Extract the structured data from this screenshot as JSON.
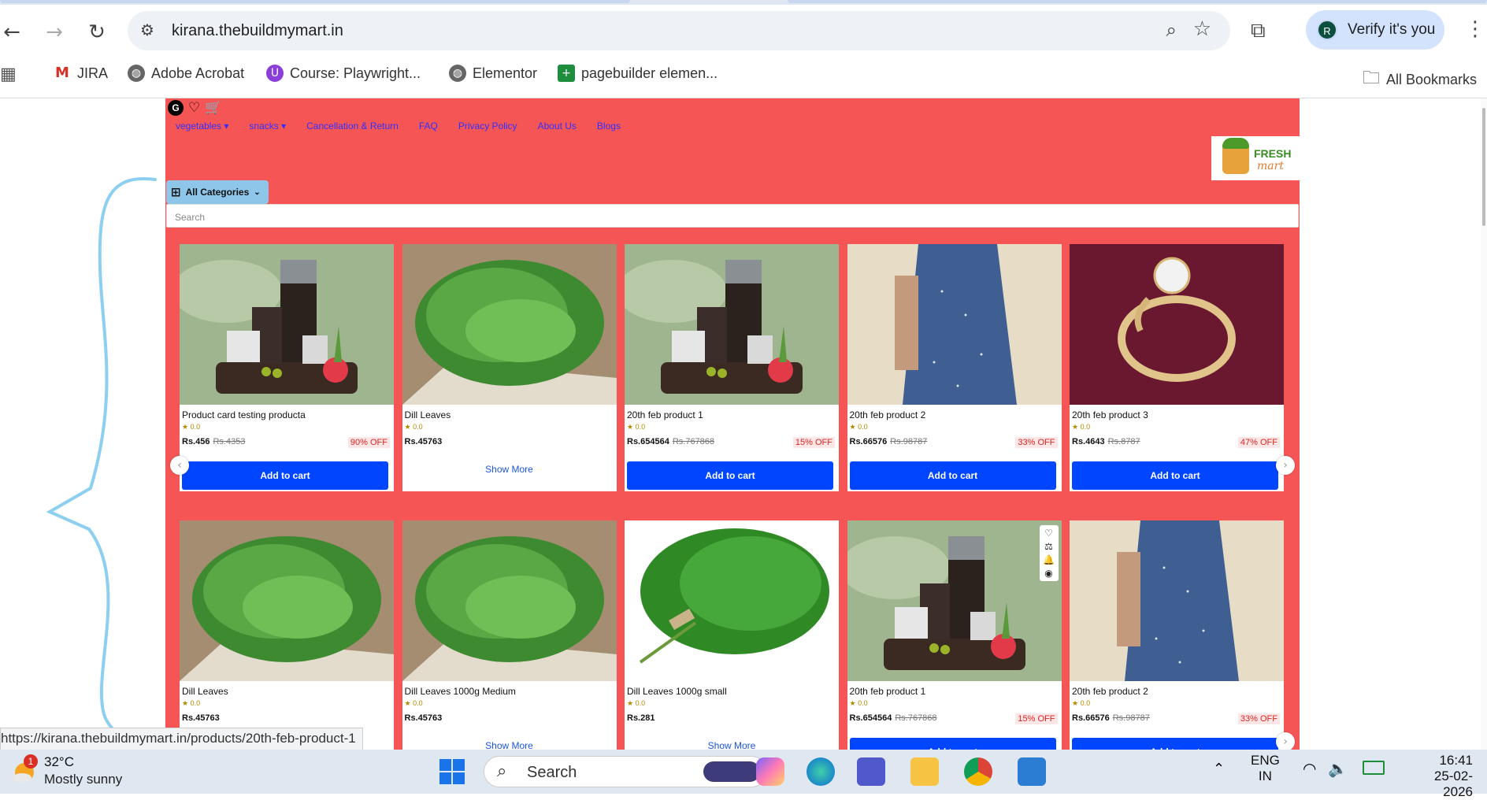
{
  "browser": {
    "url": "kirana.thebuildmymart.in",
    "profile_initial": "R",
    "verify_label": "Verify it's you",
    "bookmarks": [
      {
        "label": "JIRA",
        "icon": "gmail-icon"
      },
      {
        "label": "Adobe Acrobat",
        "icon": "globe-icon"
      },
      {
        "label": "Course: Playwright...",
        "icon": "course-icon"
      },
      {
        "label": "Elementor",
        "icon": "globe-icon"
      },
      {
        "label": "pagebuilder elemen...",
        "icon": "sheets-icon"
      }
    ],
    "all_bookmarks_label": "All Bookmarks",
    "status_url": "https://kirana.thebuildmymart.in/products/20th-feb-product-1"
  },
  "site": {
    "top_initial": "G",
    "menu": [
      {
        "label": "vegetables",
        "dropdown": true
      },
      {
        "label": "snacks",
        "dropdown": true
      },
      {
        "label": "Cancellation & Return"
      },
      {
        "label": "FAQ"
      },
      {
        "label": "Privacy Policy"
      },
      {
        "label": "About Us"
      },
      {
        "label": "Blogs"
      }
    ],
    "logo": {
      "line1": "FRESH",
      "line2": "mart"
    },
    "all_categories_label": "All Categories",
    "search_placeholder": "Search",
    "rows": [
      [
        {
          "name": "Product card testing producta",
          "rating": "0.0",
          "price": "Rs.456",
          "mrp": "Rs.4353",
          "off": "90% OFF",
          "action": "Add to cart",
          "image": "cosmetics"
        },
        {
          "name": "Dill Leaves",
          "rating": "0.0",
          "price": "Rs.45763",
          "mrp": "",
          "off": "",
          "action": "Show More",
          "image": "dill"
        },
        {
          "name": "20th feb product 1",
          "rating": "0.0",
          "price": "Rs.654564",
          "mrp": "Rs.767868",
          "off": "15% OFF",
          "action": "Add to cart",
          "image": "cosmetics"
        },
        {
          "name": "20th feb product 2",
          "rating": "0.0",
          "price": "Rs.66576",
          "mrp": "Rs.98787",
          "off": "33% OFF",
          "action": "Add to cart",
          "image": "dress"
        },
        {
          "name": "20th feb product 3",
          "rating": "0.0",
          "price": "Rs.4643",
          "mrp": "Rs.8787",
          "off": "47% OFF",
          "action": "Add to cart",
          "image": "ring"
        }
      ],
      [
        {
          "name": "Dill Leaves",
          "rating": "0.0",
          "price": "Rs.45763",
          "mrp": "",
          "off": "",
          "action": "",
          "image": "dill"
        },
        {
          "name": "Dill Leaves 1000g Medium",
          "rating": "0.0",
          "price": "Rs.45763",
          "mrp": "",
          "off": "",
          "action": "Show More",
          "image": "dill"
        },
        {
          "name": "Dill Leaves 1000g small",
          "rating": "0.0",
          "price": "Rs.281",
          "mrp": "",
          "off": "",
          "action": "Show More",
          "image": "dillbunch"
        },
        {
          "name": "20th feb product 1",
          "rating": "0.0",
          "price": "Rs.654564",
          "mrp": "Rs.767868",
          "off": "15% OFF",
          "action": "Add to cart",
          "image": "cosmetics"
        },
        {
          "name": "20th feb product 2",
          "rating": "0.0",
          "price": "Rs.66576",
          "mrp": "Rs.98787",
          "off": "33% OFF",
          "action": "Add to cart",
          "image": "dress"
        }
      ]
    ]
  },
  "taskbar": {
    "weather_badge": "1",
    "temperature": "32°C",
    "weather": "Mostly sunny",
    "search_label": "Search",
    "lang_line1": "ENG",
    "lang_line2": "IN",
    "time": "16:41",
    "date": "25-02-2026"
  },
  "colors": {
    "site_bg": "#f65555",
    "button": "#0045ff",
    "menu_link": "#3030ff",
    "discount": "#e02424"
  }
}
